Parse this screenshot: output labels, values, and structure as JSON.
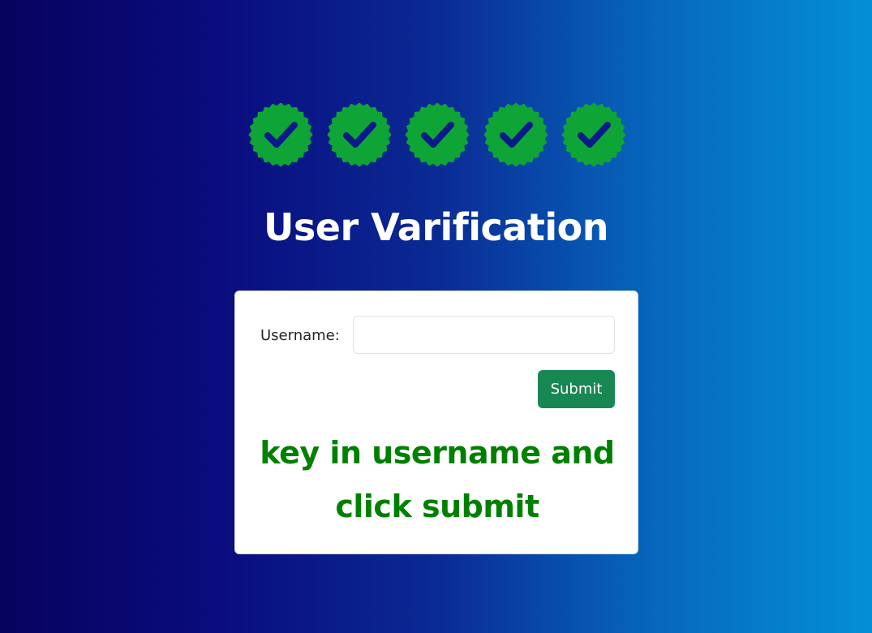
{
  "badges": {
    "count": 5,
    "icon": "verified-check-badge-icon",
    "fill_color": "#0fa536",
    "check_color": "#0a1a8a"
  },
  "page": {
    "title": "User Varification"
  },
  "form": {
    "username_label": "Username:",
    "username_value": "",
    "submit_label": "Submit",
    "hint": "key in username and click submit"
  },
  "colors": {
    "background_start": "#06035e",
    "background_end": "#048fd6",
    "submit_button": "#198754",
    "hint_text": "#008000"
  }
}
